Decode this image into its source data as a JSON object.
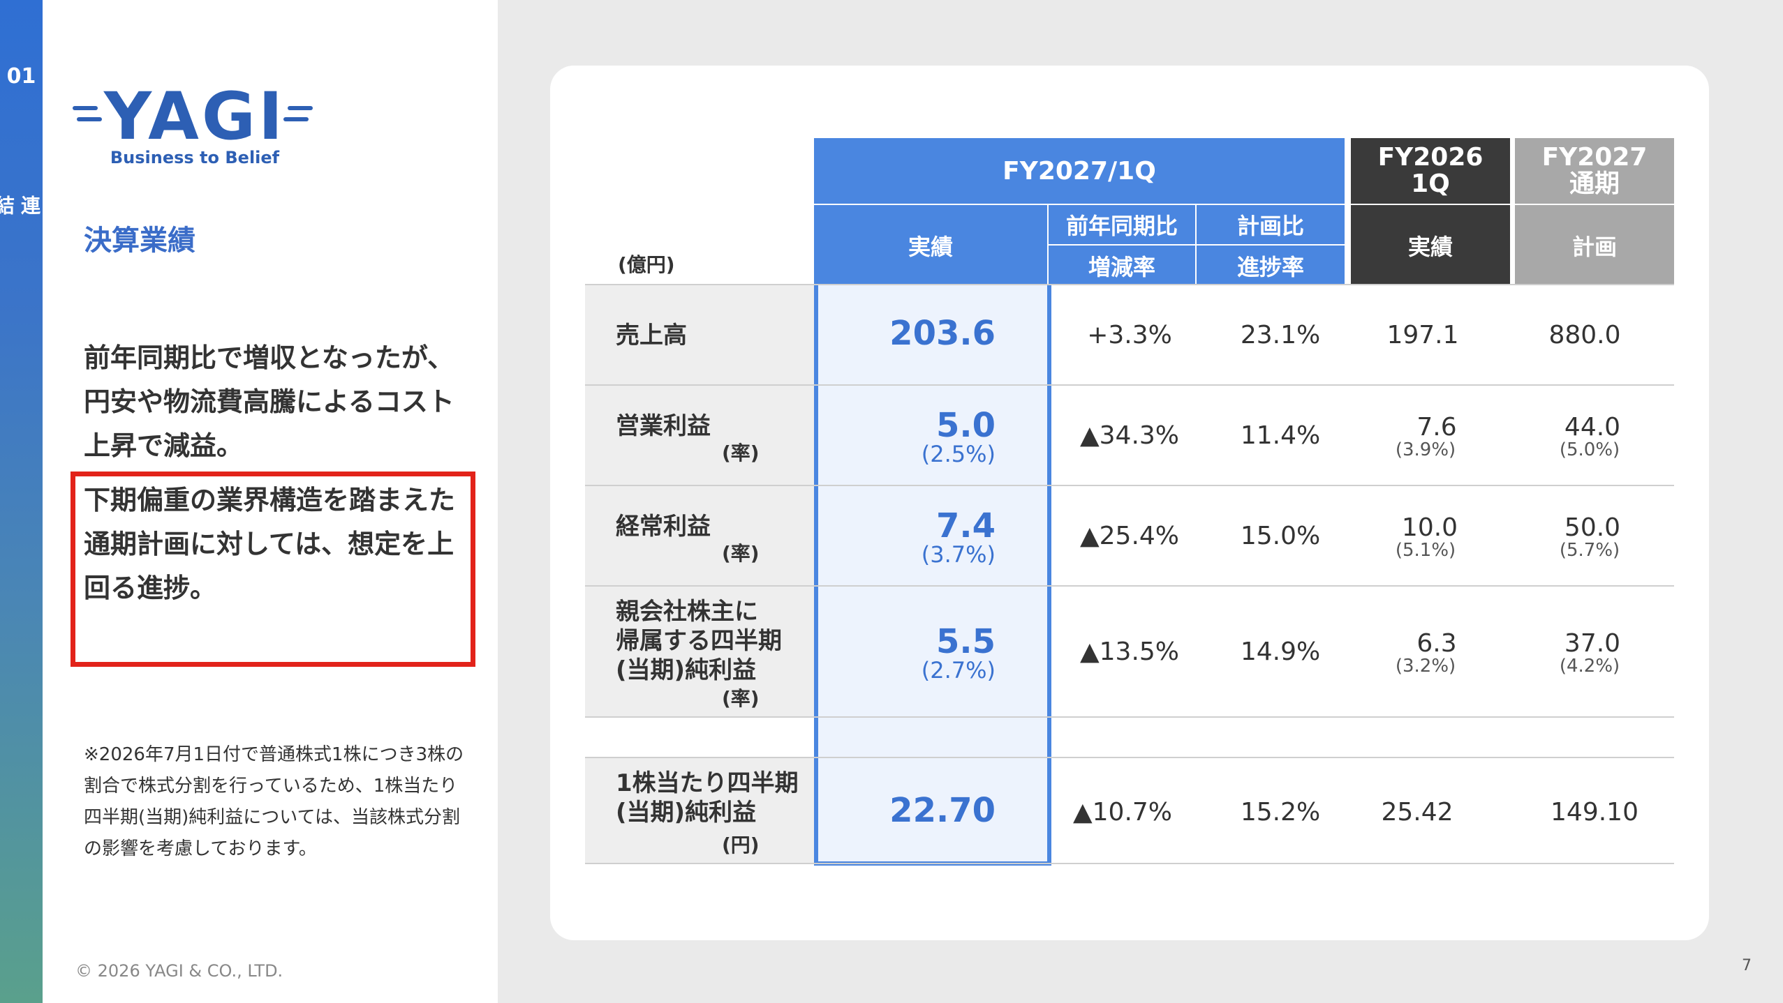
{
  "sidebar": {
    "number": "01",
    "section": "連結業績"
  },
  "logo": {
    "wordmark": "YAGI",
    "tagline": "Business to Belief"
  },
  "page_title": "決算業績",
  "lead_text": "前年同期比で増収となったが、円安や物流費高騰によるコスト上昇で減益。",
  "highlight_text": "下期偏重の業界構造を踏まえた通期計画に対しては、想定を上回る進捗。",
  "note": "※2026年7月1日付で普通株式1株につき3株の割合で株式分割を行っているため、1株当たり四半期(当期)純利益については、当該株式分割の影響を考慮しております。",
  "copyright": "© 2026 YAGI & CO., LTD.",
  "page_number": "7",
  "colors": {
    "accent_blue": "#4a86e0",
    "dark_header": "#3a3a3a",
    "gray_header": "#a8a8a8",
    "highlight_red": "#e2231a"
  },
  "table": {
    "unit": "(億円)",
    "header": {
      "fy2027_1q": "FY2027/1Q",
      "actual": "実績",
      "yoy_top": "前年同期比",
      "yoy_bottom": "増減率",
      "plan_top": "計画比",
      "plan_bottom": "進捗率",
      "fy2026_line1": "FY2026",
      "fy2026_line2": "1Q",
      "fy2026_sub": "実績",
      "fy2027_line1": "FY2027",
      "fy2027_line2": "通期",
      "fy2027_sub": "計画"
    },
    "rows": [
      {
        "label": "売上高",
        "rate_label": "",
        "actual": "203.6",
        "actual_rate": "",
        "yoy": "+3.3%",
        "progress": "23.1%",
        "prev": "197.1",
        "prev_rate": "",
        "plan": "880.0",
        "plan_rate": ""
      },
      {
        "label": "営業利益",
        "rate_label": "(率)",
        "actual": "5.0",
        "actual_rate": "(2.5%)",
        "yoy": "▲34.3%",
        "progress": "11.4%",
        "prev": "7.6",
        "prev_rate": "(3.9%)",
        "plan": "44.0",
        "plan_rate": "(5.0%)"
      },
      {
        "label": "経常利益",
        "rate_label": "(率)",
        "actual": "7.4",
        "actual_rate": "(3.7%)",
        "yoy": "▲25.4%",
        "progress": "15.0%",
        "prev": "10.0",
        "prev_rate": "(5.1%)",
        "plan": "50.0",
        "plan_rate": "(5.7%)"
      },
      {
        "label": "親会社株主に帰属する四半期(当期)純利益",
        "label_lines": [
          "親会社株主に",
          "帰属する四半期",
          "(当期)純利益"
        ],
        "rate_label": "(率)",
        "actual": "5.5",
        "actual_rate": "(2.7%)",
        "yoy": "▲13.5%",
        "progress": "14.9%",
        "prev": "6.3",
        "prev_rate": "(3.2%)",
        "plan": "37.0",
        "plan_rate": "(4.2%)"
      },
      {
        "label": "1株当たり四半期(当期)純利益",
        "label_lines": [
          "1株当たり四半期",
          "(当期)純利益"
        ],
        "rate_label": "(円)",
        "actual": "22.70",
        "actual_rate": "",
        "yoy": "▲10.7%",
        "progress": "15.2%",
        "prev": "25.42",
        "prev_rate": "",
        "plan": "149.10",
        "plan_rate": ""
      }
    ]
  }
}
